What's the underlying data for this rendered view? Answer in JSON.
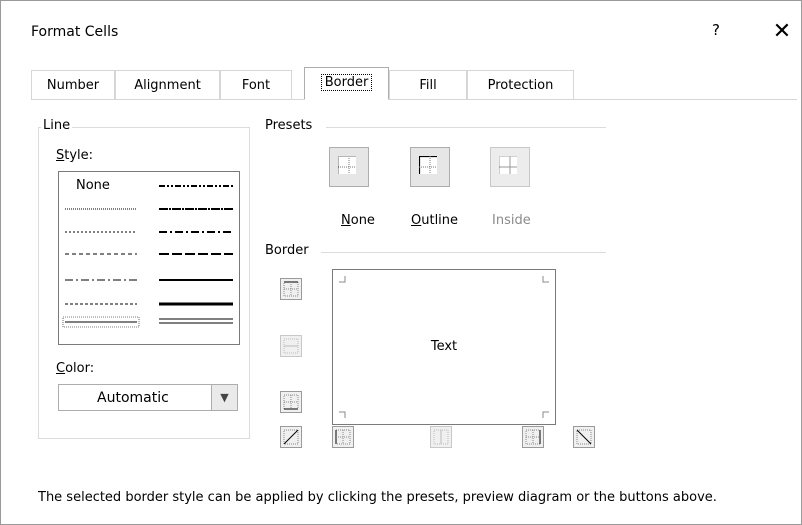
{
  "dialog": {
    "title": "Format Cells",
    "help_label": "?",
    "close_label": "✕"
  },
  "tabs": [
    {
      "label": "Number"
    },
    {
      "label": "Alignment"
    },
    {
      "label": "Font"
    },
    {
      "label": "Border",
      "active": true
    },
    {
      "label": "Fill"
    },
    {
      "label": "Protection"
    }
  ],
  "line_group": {
    "title": "Line",
    "style_label": "Style:",
    "style_none": "None",
    "color_label": "Color:",
    "color_value": "Automatic"
  },
  "presets_group": {
    "title": "Presets",
    "none": "None",
    "outline": "Outline",
    "inside": "Inside"
  },
  "border_group": {
    "title": "Border",
    "preview_text": "Text"
  },
  "description": "The selected border style can be applied by clicking the presets, preview diagram or the buttons above."
}
